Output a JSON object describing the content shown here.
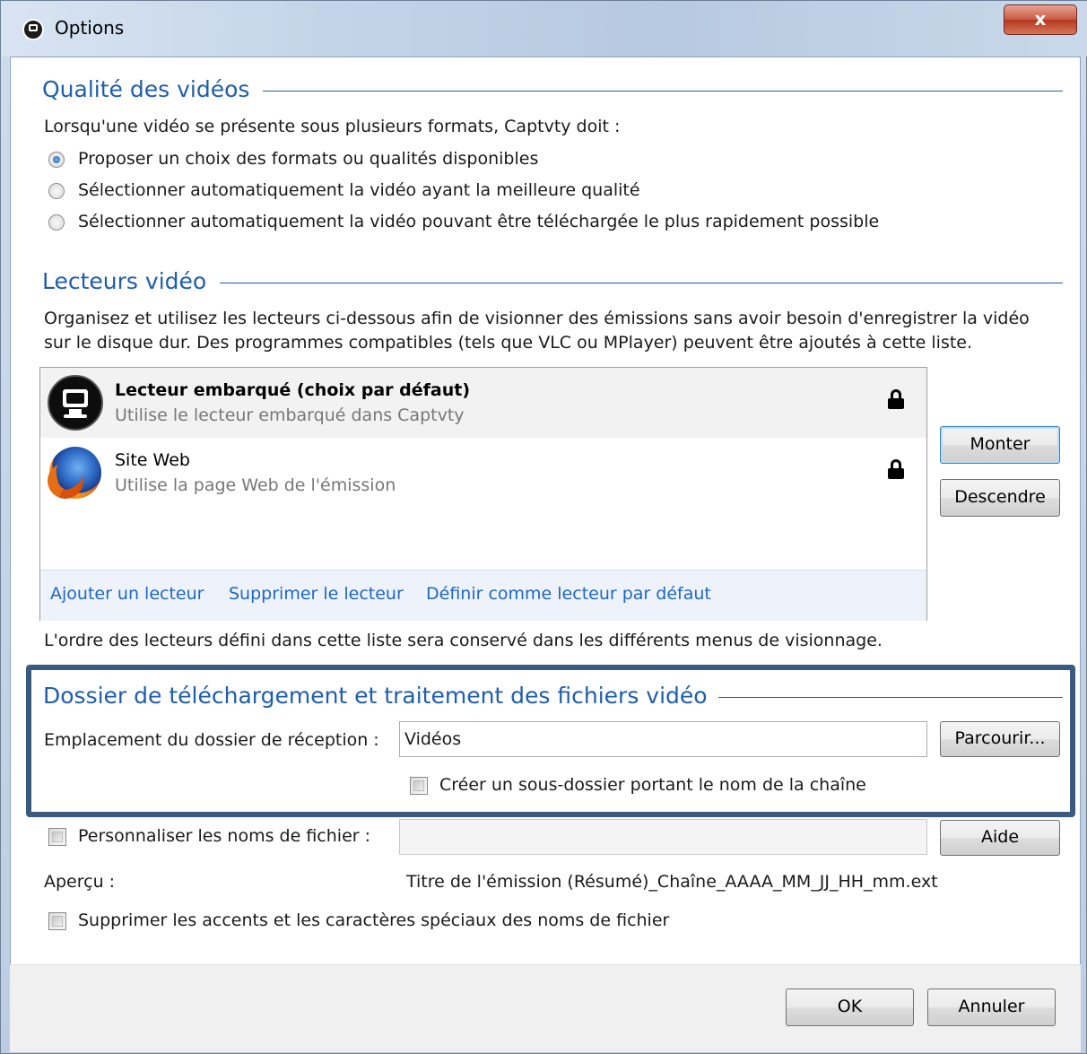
{
  "window": {
    "title": "Options",
    "close_label": "x"
  },
  "video_quality": {
    "title": "Qualité des vidéos",
    "intro": "Lorsqu'une vidéo se présente sous plusieurs formats, Captvty doit :",
    "options": [
      {
        "label": "Proposer un choix des formats ou qualités disponibles",
        "selected": true
      },
      {
        "label": "Sélectionner automatiquement la vidéo ayant la meilleure qualité",
        "selected": false
      },
      {
        "label": "Sélectionner automatiquement la vidéo pouvant être téléchargée le plus rapidement possible",
        "selected": false
      }
    ]
  },
  "players": {
    "title": "Lecteurs vidéo",
    "description_line1": "Organisez et utilisez les lecteurs ci-dessous afin de visionner des émissions sans avoir besoin d'enregistrer la vidéo",
    "description_line2": "sur le disque dur. Des programmes compatibles (tels que VLC ou MPlayer) peuvent être ajoutés à cette liste.",
    "items": [
      {
        "name": "Lecteur embarqué (choix par défaut)",
        "description": "Utilise le lecteur embarqué dans Captvty",
        "icon": "monitor-icon",
        "locked": true
      },
      {
        "name": "Site Web",
        "description": "Utilise la page Web de l'émission",
        "icon": "firefox-icon",
        "locked": true
      }
    ],
    "links": {
      "add": "Ajouter un lecteur",
      "remove": "Supprimer le lecteur",
      "set_default": "Définir comme lecteur par défaut"
    },
    "buttons": {
      "up": "Monter",
      "down": "Descendre"
    },
    "order_note": "L'ordre des lecteurs défini dans cette liste sera conservé dans les différents menus de visionnage."
  },
  "download": {
    "title": "Dossier de téléchargement et traitement des fichiers vidéo",
    "folder_label": "Emplacement du dossier de réception :",
    "folder_value": "Vidéos",
    "browse_label": "Parcourir...",
    "subfolder_label": "Créer un sous-dossier portant le nom de la chaîne",
    "subfolder_checked": false,
    "customize_label": "Personnaliser les noms de fichier :",
    "customize_checked": false,
    "customize_value": "",
    "help_label": "Aide",
    "preview_label": "Aperçu :",
    "preview_value": "Titre de l'émission (Résumé)_Chaîne_AAAA_MM_JJ_HH_mm.ext",
    "strip_accents_label": "Supprimer les accents et les caractères spéciaux des noms de fichier",
    "strip_accents_checked": false
  },
  "footer": {
    "ok_label": "OK",
    "cancel_label": "Annuler"
  },
  "colors": {
    "section_title": "#1e5eab",
    "link": "#1f66c6",
    "highlight_border": "#3b5a80"
  }
}
